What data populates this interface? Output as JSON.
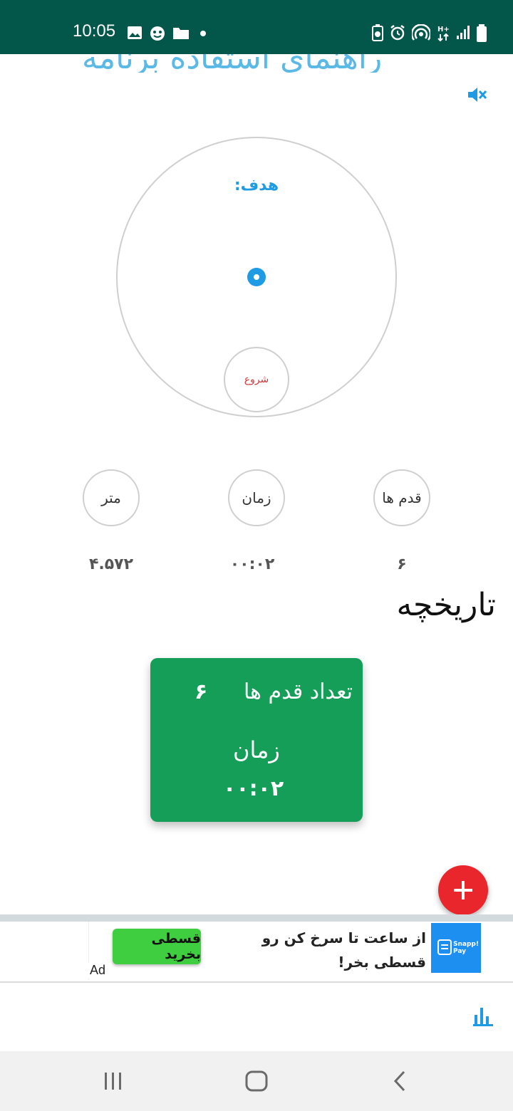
{
  "status_bar": {
    "time": "10:05"
  },
  "header": {
    "title": "راهنمای استفاده برنامه"
  },
  "goal": {
    "label": "هدف:",
    "start_label": "شروع"
  },
  "stats": {
    "steps_label": "قدم ها",
    "time_label": "زمان",
    "distance_label": "متر",
    "steps_value": "۶",
    "time_value": "۰۰:۰۲",
    "distance_value": "۴.۵۷۲"
  },
  "history": {
    "title": "تاریخچه",
    "card": {
      "steps_label": "تعداد قدم ها",
      "steps_value": "۶",
      "time_label": "زمان",
      "time_value": "۰۰:۰۲"
    }
  },
  "ad": {
    "tag": "Ad",
    "text": "از ساعت تا سرخ کن رو قسطی بخر!",
    "button_label": "قسطی بخرید",
    "logo_line1": "Snapp!",
    "logo_line2": "Pay"
  },
  "colors": {
    "status_bar": "#03574a",
    "accent_blue": "#1e9be4",
    "card_green": "#149e57",
    "fab_red": "#e8262c",
    "start_red": "#d03a3a"
  }
}
